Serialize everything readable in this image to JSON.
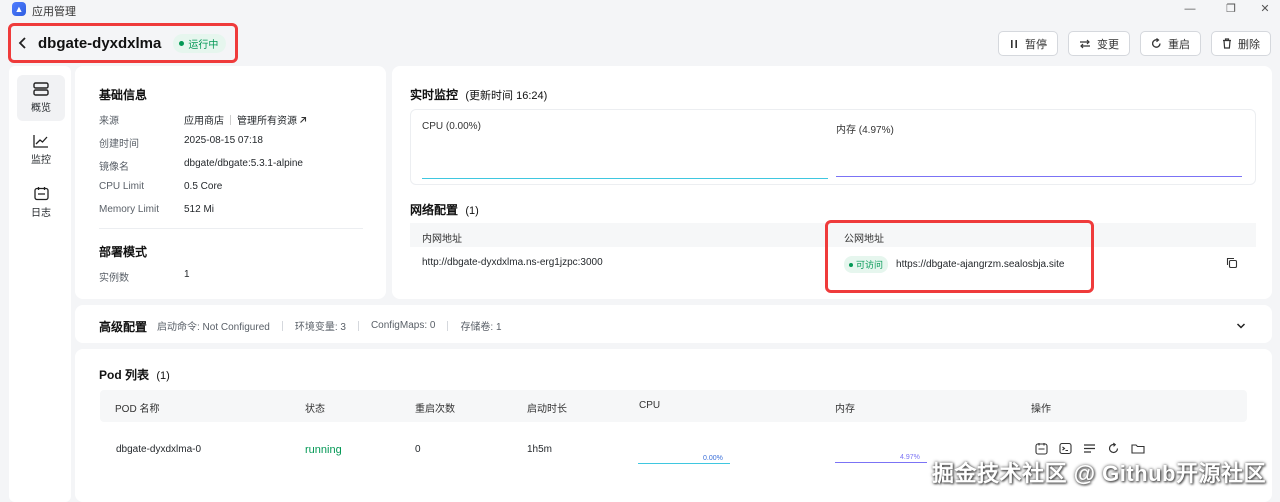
{
  "window": {
    "title": "应用管理",
    "logo_icon": "rocket-icon"
  },
  "header": {
    "app_name": "dbgate-dyxdxlma",
    "status": "运行中",
    "actions": [
      {
        "label": "暂停",
        "icon": "pause-icon"
      },
      {
        "label": "变更",
        "icon": "swap-icon"
      },
      {
        "label": "重启",
        "icon": "restart-icon"
      },
      {
        "label": "删除",
        "icon": "trash-icon"
      }
    ]
  },
  "sidebar": {
    "items": [
      {
        "label": "概览",
        "icon": "overview-icon",
        "active": true
      },
      {
        "label": "监控",
        "icon": "chart-icon",
        "active": false
      },
      {
        "label": "日志",
        "icon": "log-icon",
        "active": false
      }
    ]
  },
  "basic_info": {
    "title": "基础信息",
    "rows": [
      {
        "label": "来源",
        "value": "应用商店",
        "extra": "管理所有资源"
      },
      {
        "label": "创建时间",
        "value": "2025-08-15 07:18"
      },
      {
        "label": "镜像名",
        "value": "dbgate/dbgate:5.3.1-alpine"
      },
      {
        "label": "CPU Limit",
        "value": "0.5 Core"
      },
      {
        "label": "Memory Limit",
        "value": "512 Mi"
      }
    ],
    "deploy_title": "部署模式",
    "deploy_rows": [
      {
        "label": "实例数",
        "value": "1"
      }
    ]
  },
  "monitor": {
    "title": "实时监控",
    "subtitle": "(更新时间  16:24)",
    "cpu_label": "CPU  (0.00%)",
    "mem_label": "内存  (4.97%)",
    "cpu_color": "#3fc7e0",
    "mem_color": "#7b73f5"
  },
  "network": {
    "title": "网络配置",
    "count": "(1)",
    "col_internal": "内网地址",
    "col_public": "公网地址",
    "internal_addr": "http://dbgate-dyxdxlma.ns-erg1jzpc:3000",
    "public_status": "可访问",
    "public_addr": "https://dbgate-ajangrzm.sealosbja.site"
  },
  "advanced": {
    "title": "高级配置",
    "items": [
      "启动命令: Not Configured",
      "环境变量: 3",
      "ConfigMaps: 0",
      "存储卷: 1"
    ]
  },
  "pods": {
    "title": "Pod 列表",
    "count": "(1)",
    "columns": [
      "POD 名称",
      "状态",
      "重启次数",
      "启动时长",
      "CPU",
      "内存",
      "操作"
    ],
    "rows": [
      {
        "name": "dbgate-dyxdxlma-0",
        "status": "running",
        "restarts": "0",
        "uptime": "1h5m",
        "cpu": "0.00%",
        "mem": "4.97%"
      }
    ]
  },
  "watermark": "掘金技术社区 @ Github开源社区"
}
